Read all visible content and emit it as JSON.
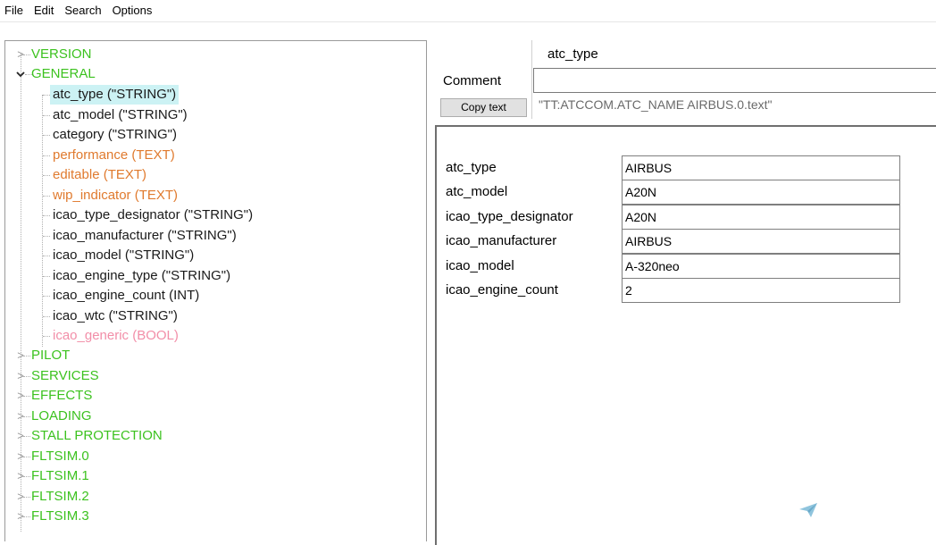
{
  "menu": [
    "File",
    "Edit",
    "Search",
    "Options"
  ],
  "tree": {
    "sections": [
      {
        "label": "VERSION",
        "expanded": false
      },
      {
        "label": "GENERAL",
        "expanded": true,
        "children": [
          {
            "label": "atc_type (\"STRING\")",
            "color": "#1a1a1a",
            "selected": true
          },
          {
            "label": "atc_model (\"STRING\")",
            "color": "#1a1a1a"
          },
          {
            "label": "category (\"STRING\")",
            "color": "#1a1a1a"
          },
          {
            "label": "performance (TEXT)",
            "color": "#e07a2e"
          },
          {
            "label": "editable (TEXT)",
            "color": "#e07a2e"
          },
          {
            "label": "wip_indicator (TEXT)",
            "color": "#e07a2e"
          },
          {
            "label": "icao_type_designator (\"STRING\")",
            "color": "#1a1a1a"
          },
          {
            "label": "icao_manufacturer (\"STRING\")",
            "color": "#1a1a1a"
          },
          {
            "label": "icao_model (\"STRING\")",
            "color": "#1a1a1a"
          },
          {
            "label": "icao_engine_type (\"STRING\")",
            "color": "#1a1a1a"
          },
          {
            "label": "icao_engine_count (INT)",
            "color": "#1a1a1a"
          },
          {
            "label": "icao_wtc (\"STRING\")",
            "color": "#1a1a1a"
          },
          {
            "label": "icao_generic (BOOL)",
            "color": "#f28ea8"
          }
        ]
      },
      {
        "label": "PILOT",
        "expanded": false
      },
      {
        "label": "SERVICES",
        "expanded": false
      },
      {
        "label": "EFFECTS",
        "expanded": false
      },
      {
        "label": "LOADING",
        "expanded": false
      },
      {
        "label": "STALL PROTECTION",
        "expanded": false
      },
      {
        "label": "FLTSIM.0",
        "expanded": false
      },
      {
        "label": "FLTSIM.1",
        "expanded": false
      },
      {
        "label": "FLTSIM.2",
        "expanded": false
      },
      {
        "label": "FLTSIM.3",
        "expanded": false
      }
    ]
  },
  "editor": {
    "field_name": "atc_type",
    "comment_label": "Comment",
    "comment_value": "",
    "copy_button": "Copy text",
    "copy_value": "\"TT:ATCCOM.ATC_NAME AIRBUS.0.text\""
  },
  "properties": [
    {
      "name": "atc_type",
      "value": "AIRBUS"
    },
    {
      "name": "atc_model",
      "value": "A20N"
    },
    {
      "name": "icao_type_designator",
      "value": "A20N"
    },
    {
      "name": "icao_manufacturer",
      "value": "AIRBUS"
    },
    {
      "name": "icao_model",
      "value": "A-320neo"
    },
    {
      "name": "icao_engine_count",
      "value": "2"
    }
  ],
  "colors": {
    "section": "#3cc21f",
    "selection_bg": "#ccf2f4",
    "send_icon": "#8fc4dd"
  },
  "icons": {
    "collapsed": "chevron-right-icon",
    "expanded": "chevron-down-icon",
    "send": "send-icon"
  }
}
